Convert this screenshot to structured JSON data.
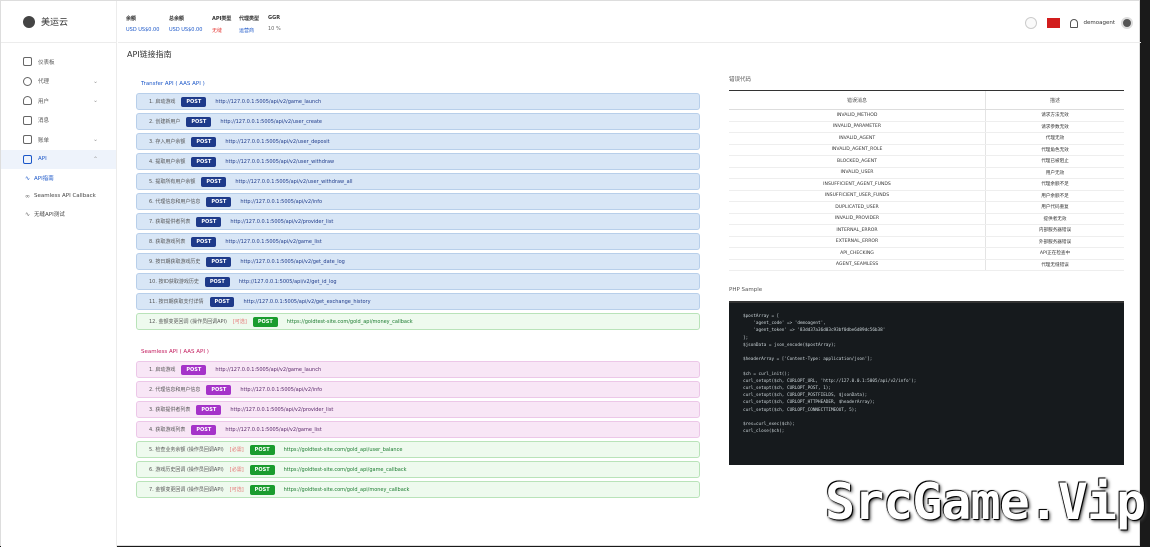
{
  "app": {
    "name": "美运云"
  },
  "sidebar": {
    "items": [
      {
        "label": "仪表板",
        "icon": "home-icon"
      },
      {
        "label": "代理",
        "icon": "share-icon"
      },
      {
        "label": "用户",
        "icon": "user-icon"
      },
      {
        "label": "消息",
        "icon": "mail-icon"
      },
      {
        "label": "账单",
        "icon": "wallet-icon"
      },
      {
        "label": "API",
        "icon": "document-icon"
      }
    ],
    "sub_items": [
      {
        "label": "API指南",
        "icon": "pulse-icon"
      },
      {
        "label": "Seamless API Callback",
        "icon": "link-icon"
      },
      {
        "label": "无缝API测试",
        "icon": "pulse-icon"
      }
    ]
  },
  "header": {
    "stats": [
      {
        "label": "余额",
        "value": "USD US$0.00"
      },
      {
        "label": "总余额",
        "value": "USD US$0.00"
      },
      {
        "label": "API类型",
        "value": "无缝"
      },
      {
        "label": "代理类型",
        "value": "运营商"
      },
      {
        "label": "GGR",
        "value": "10 %"
      }
    ],
    "username": "demoagent"
  },
  "main": {
    "page_title": "API链接指南",
    "transfer_title": "Transfer API ( AAS API )",
    "seamless_title": "Seamless API ( AAS API )",
    "transfer_rows": [
      {
        "name": "1. 启动游戏",
        "method": "POST",
        "url": "http://127.0.0.1:5005/api/v2/game_launch"
      },
      {
        "name": "2. 创建新用户",
        "method": "POST",
        "url": "http://127.0.0.1:5005/api/v2/user_create"
      },
      {
        "name": "3. 存入用户余额",
        "method": "POST",
        "url": "http://127.0.0.1:5005/api/v2/user_deposit"
      },
      {
        "name": "4. 提取用户余额",
        "method": "POST",
        "url": "http://127.0.0.1:5005/api/v2/user_withdraw"
      },
      {
        "name": "5. 提取所有用户余额",
        "method": "POST",
        "url": "http://127.0.0.1:5005/api/v2/user_withdraw_all"
      },
      {
        "name": "6. 代理信息和用户信息",
        "method": "POST",
        "url": "http://127.0.0.1:5005/api/v2/info"
      },
      {
        "name": "7. 获取提供者列表",
        "method": "POST",
        "url": "http://127.0.0.1:5005/api/v2/provider_list"
      },
      {
        "name": "8. 获取游戏列表",
        "method": "POST",
        "url": "http://127.0.0.1:5005/api/v2/game_list"
      },
      {
        "name": "9. 按日期获取游戏历史",
        "method": "POST",
        "url": "http://127.0.0.1:5005/api/v2/get_date_log"
      },
      {
        "name": "10. 按ID获取游戏历史",
        "method": "POST",
        "url": "http://127.0.0.1:5005/api/v2/get_id_log"
      },
      {
        "name": "11. 按日期获取支付详情",
        "method": "POST",
        "url": "http://127.0.0.1:5005/api/v2/get_exchange_history"
      },
      {
        "name": "12. 金额变更回调 (操作员回调API)",
        "optional": "[可选]",
        "method": "POST",
        "url": "https://goldtest-site.com/gold_api/money_callback"
      }
    ],
    "seamless_rows": [
      {
        "name": "1. 启动游戏",
        "method": "POST",
        "url": "http://127.0.0.1:5005/api/v2/game_launch"
      },
      {
        "name": "2. 代理信息和用户信息",
        "method": "POST",
        "url": "http://127.0.0.1:5005/api/v2/info"
      },
      {
        "name": "3. 获取提供者列表",
        "method": "POST",
        "url": "http://127.0.0.1:5005/api/v2/provider_list"
      },
      {
        "name": "4. 获取游戏列表",
        "method": "POST",
        "url": "http://127.0.0.1:5005/api/v2/game_list"
      },
      {
        "name": "5. 检查业务余额 (操作员回调API)",
        "optional": "[必需]",
        "method": "POST",
        "url": "https://goldtest-site.com/gold_api/user_balance"
      },
      {
        "name": "6. 游戏历史回调 (操作员回调API)",
        "optional": "[必需]",
        "method": "POST",
        "url": "https://goldtest-site.com/gold_api/game_callback"
      },
      {
        "name": "7. 金额变更回调 (操作员回调API)",
        "optional": "[可选]",
        "method": "POST",
        "url": "https://goldtest-site.com/gold_api/money_callback"
      }
    ]
  },
  "errors": {
    "title": "错误代码",
    "headers": [
      "错误消息",
      "描述"
    ],
    "rows": [
      [
        "INVALID_METHOD",
        "请求方法无效"
      ],
      [
        "INVALID_PARAMETER",
        "请求参数无效"
      ],
      [
        "INVALID_AGENT",
        "代理无效"
      ],
      [
        "INVALID_AGENT_ROLE",
        "代理角色无效"
      ],
      [
        "BLOCKED_AGENT",
        "代理已被阻止"
      ],
      [
        "INVALID_USER",
        "用户无效"
      ],
      [
        "INSUFFICIENT_AGENT_FUNDS",
        "代理余额不足"
      ],
      [
        "INSUFFICIENT_USER_FUNDS",
        "用户余额不足"
      ],
      [
        "DUPLICATED_USER",
        "用户代码重复"
      ],
      [
        "INVALID_PROVIDER",
        "提供者无效"
      ],
      [
        "INTERNAL_ERROR",
        "内部服务器错误"
      ],
      [
        "EXTERNAL_ERROR",
        "外部服务器错误"
      ],
      [
        "API_CHECKING",
        "API正在检查中"
      ],
      [
        "AGENT_SEAMLESS",
        "代理无缝错误"
      ]
    ]
  },
  "php": {
    "title": "PHP Sample",
    "code": "$postArray = [\n    'agent_code' => 'demoagent',\n    'agent_token' => '83dd37a36d03c93bf0dbe6d89dc56b38'\n];\n$jsonData = json_encode($postArray);\n\n$headerArray = ['Content-Type: application/json'];\n\n$ch = curl_init();\ncurl_setopt($ch, CURLOPT_URL, 'http://127.0.0.1:5005/api/v2/info');\ncurl_setopt($ch, CURLOPT_POST, 1);\ncurl_setopt($ch, CURLOPT_POSTFIELDS, $jsonData);\ncurl_setopt($ch, CURLOPT_HTTPHEADER, $headerArray);\ncurl_setopt($ch, CURLOPT_CONNECTTIMEOUT, 5);\n\n$res=curl_exec($ch);\ncurl_close($ch);"
  },
  "watermark": "SrcGame.Vip"
}
